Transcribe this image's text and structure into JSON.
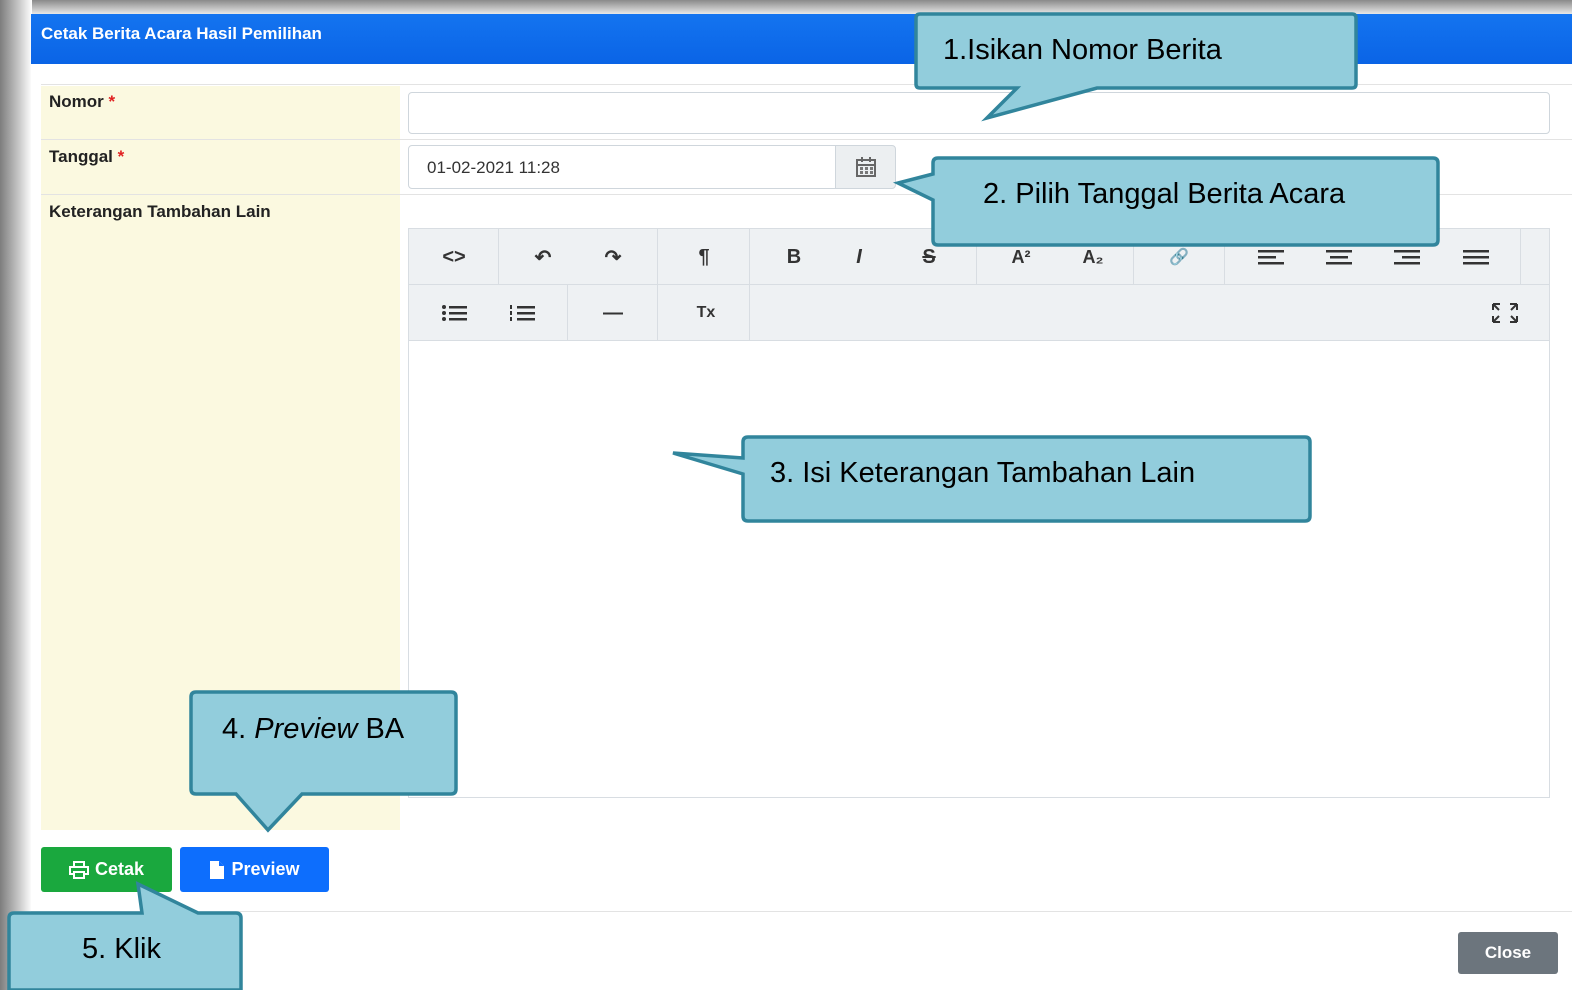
{
  "modal": {
    "title": "Cetak Berita Acara Hasil Pemilihan"
  },
  "form": {
    "nomor_label": "Nomor",
    "tanggal_label": "Tanggal",
    "required_mark": "*",
    "keterangan_label": "Keterangan Tambahan Lain",
    "nomor_value": "",
    "tanggal_value": "01-02-2021 11:28"
  },
  "toolbar": {
    "code": "<>",
    "undo": "↶",
    "redo": "↷",
    "paragraph": "¶",
    "bold": "B",
    "italic": "I",
    "strike": "S",
    "superscript": "A²",
    "subscript": "A₂",
    "link": "🔗",
    "clear_format": "Tx",
    "hr": "—"
  },
  "buttons": {
    "cetak": "Cetak",
    "preview": "Preview",
    "close": "Close"
  },
  "callouts": {
    "c1": "1.Isikan Nomor Berita",
    "c2": "2. Pilih Tanggal Berita Acara",
    "c3": "3. Isi Keterangan Tambahan Lain",
    "c4_num": "4.",
    "c4_italic": "Preview",
    "c4_rest": "BA",
    "c5": "5. Klik"
  },
  "colors": {
    "header": "#0d6efd",
    "label_bg": "#fbf9e0",
    "callout_fill": "#92cddc",
    "callout_stroke": "#31859c",
    "cetak": "#1aa83e",
    "close": "#6c757d"
  }
}
